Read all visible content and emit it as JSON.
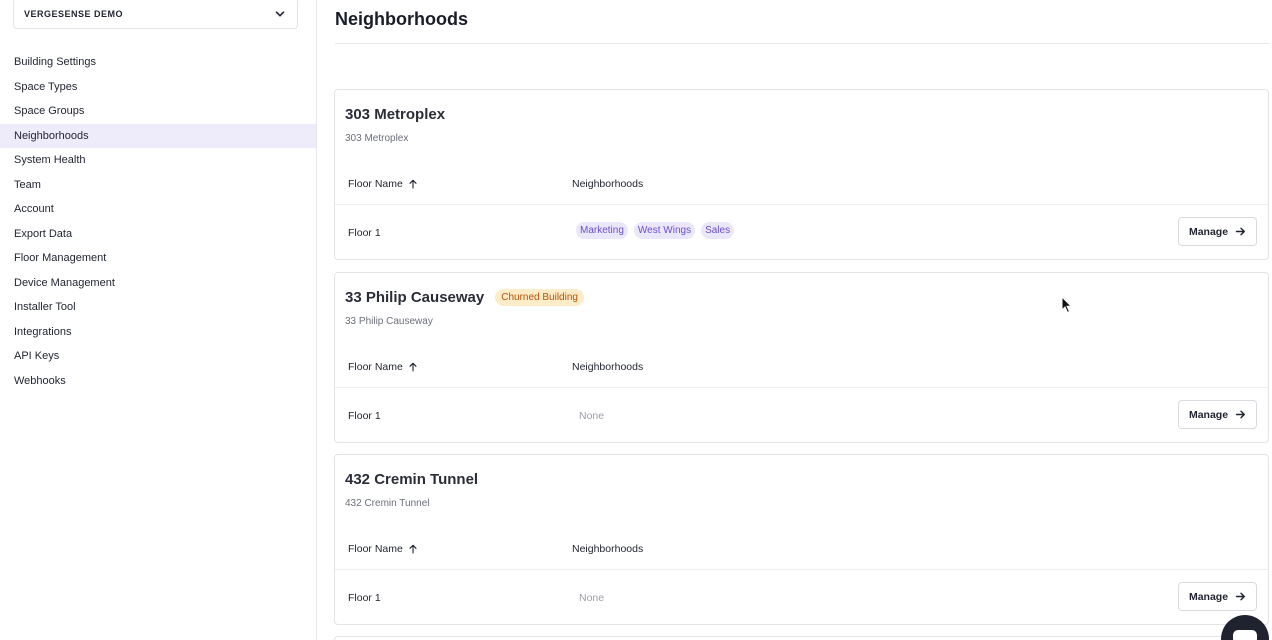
{
  "sidebar": {
    "org_name": "VERGESENSE DEMO",
    "items": [
      {
        "label": "Building Settings",
        "active": false
      },
      {
        "label": "Space Types",
        "active": false
      },
      {
        "label": "Space Groups",
        "active": false
      },
      {
        "label": "Neighborhoods",
        "active": true
      },
      {
        "label": "System Health",
        "active": false
      },
      {
        "label": "Team",
        "active": false
      },
      {
        "label": "Account",
        "active": false
      },
      {
        "label": "Export Data",
        "active": false
      },
      {
        "label": "Floor Management",
        "active": false
      },
      {
        "label": "Device Management",
        "active": false
      },
      {
        "label": "Installer Tool",
        "active": false
      },
      {
        "label": "Integrations",
        "active": false
      },
      {
        "label": "API Keys",
        "active": false
      },
      {
        "label": "Webhooks",
        "active": false
      }
    ]
  },
  "main": {
    "title": "Neighborhoods",
    "table_headers": {
      "floor_name": "Floor Name",
      "neighborhoods": "Neighborhoods"
    },
    "manage_label": "Manage",
    "buildings": [
      {
        "name": "303 Metroplex",
        "address": "303 Metroplex",
        "badge": "",
        "floor": "Floor 1",
        "neighborhoods": [
          "Marketing",
          "West Wings",
          "Sales"
        ],
        "none_label": ""
      },
      {
        "name": "33 Philip Causeway",
        "address": "33 Philip Causeway",
        "badge": "Churned Building",
        "floor": "Floor 1",
        "neighborhoods": [],
        "none_label": "None"
      },
      {
        "name": "432 Cremin Tunnel",
        "address": "432 Cremin Tunnel",
        "badge": "",
        "floor": "Floor 1",
        "neighborhoods": [],
        "none_label": "None"
      }
    ]
  },
  "colors": {
    "accent": "#6b4fc7",
    "active_nav_bg": "#eeebfb",
    "badge_text": "#b45309",
    "badge_bg": "#fdecc8"
  },
  "icons": {
    "org_dropdown": "chevron-down-icon",
    "sort": "arrow-up-icon",
    "manage": "arrow-right-icon",
    "chat": "chat-icon",
    "cursor": "mouse-pointer-icon"
  }
}
